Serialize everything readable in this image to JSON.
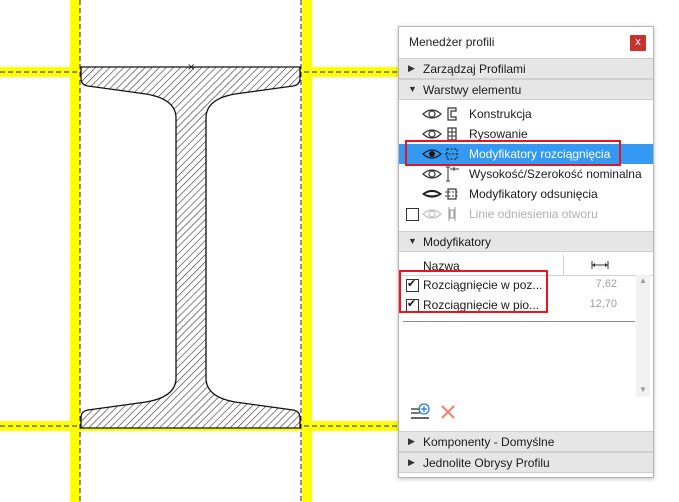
{
  "panel": {
    "title": "Menedżer profili",
    "close_glyph": "x"
  },
  "sections": {
    "manage": "Zarządzaj Profilami",
    "layers": "Warstwy elementu",
    "modifiers": "Modyfikatory",
    "components": "Komponenty - Domyślne",
    "outlines": "Jednolite Obrysy Profilu"
  },
  "layers": [
    {
      "label": "Konstrukcja",
      "icon": "structure-icon",
      "visible": true
    },
    {
      "label": "Rysowanie",
      "icon": "drawing-icon",
      "visible": true
    },
    {
      "label": "Modyfikatory rozciągnięcia",
      "icon": "stretch-modifier-icon",
      "visible": true,
      "selected": true
    },
    {
      "label": "Wysokość/Szerokość nominalna",
      "icon": "nominal-size-icon",
      "visible": true
    },
    {
      "label": "Modyfikatory odsunięcia",
      "icon": "offset-modifier-icon",
      "visible": false
    },
    {
      "label": "Linie odniesienia otworu",
      "icon": "opening-reference-icon",
      "visible": true,
      "disabled": true
    }
  ],
  "modifiers_table": {
    "col_name": "Nazwa",
    "col_value_icon": "dimension-icon",
    "rows": [
      {
        "name": "Rozciągnięcie w poz...",
        "value": "7,62",
        "checked": true
      },
      {
        "name": "Rozciągnięcie w pio...",
        "value": "12,70",
        "checked": true
      }
    ]
  },
  "toolbar": {
    "add_icon": "add-modifier-icon",
    "delete_icon": "delete-icon"
  },
  "colors": {
    "accent": "#3399f3",
    "highlight": "#e8141e",
    "guide": "#ffff00",
    "close": "#c8322e"
  }
}
